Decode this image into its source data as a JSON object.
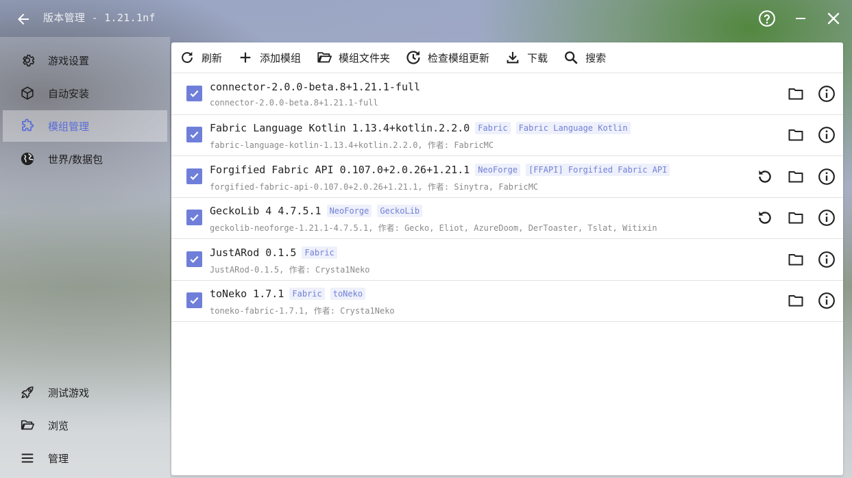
{
  "window": {
    "title": "版本管理 - 1.21.1nf",
    "help_icon": "help-circle-icon",
    "minimize_icon": "minimize-icon",
    "close_icon": "close-icon"
  },
  "sidebar": {
    "items": [
      {
        "label": "游戏设置",
        "icon": "gear-icon",
        "active": false
      },
      {
        "label": "自动安装",
        "icon": "cube-icon",
        "active": false
      },
      {
        "label": "模组管理",
        "icon": "puzzle-icon",
        "active": true
      },
      {
        "label": "世界/数据包",
        "icon": "globe-icon",
        "active": false
      }
    ],
    "bottom_items": [
      {
        "label": "测试游戏",
        "icon": "rocket-icon"
      },
      {
        "label": "浏览",
        "icon": "folder-open-icon"
      },
      {
        "label": "管理",
        "icon": "menu-icon"
      }
    ]
  },
  "toolbar": {
    "refresh": "刷新",
    "add_mod": "添加模组",
    "mod_folder": "模组文件夹",
    "check_updates": "检查模组更新",
    "download": "下载",
    "search": "搜索"
  },
  "mods": [
    {
      "name": "connector-2.0.0-beta.8+1.21.1-full",
      "tags": [],
      "sub": "connector-2.0.0-beta.8+1.21.1-full",
      "enabled": true,
      "has_revert": false
    },
    {
      "name": "Fabric Language Kotlin 1.13.4+kotlin.2.2.0",
      "tags": [
        "Fabric",
        "Fabric Language Kotlin"
      ],
      "sub": "fabric-language-kotlin-1.13.4+kotlin.2.2.0, 作者: FabricMC",
      "enabled": true,
      "has_revert": false
    },
    {
      "name": "Forgified Fabric API 0.107.0+2.0.26+1.21.1",
      "tags": [
        "NeoForge",
        "[FFAPI] Forgified Fabric API"
      ],
      "sub": "forgified-fabric-api-0.107.0+2.0.26+1.21.1, 作者: Sinytra, FabricMC",
      "enabled": true,
      "has_revert": true
    },
    {
      "name": "GeckoLib 4 4.7.5.1",
      "tags": [
        "NeoForge",
        "GeckoLib"
      ],
      "sub": "geckolib-neoforge-1.21.1-4.7.5.1, 作者: Gecko, Eliot, AzureDoom, DerToaster, Tslat, Witixin",
      "enabled": true,
      "has_revert": true
    },
    {
      "name": "JustARod 0.1.5",
      "tags": [
        "Fabric"
      ],
      "sub": "JustARod-0.1.5, 作者: Crysta1Neko",
      "enabled": true,
      "has_revert": false
    },
    {
      "name": "toNeko 1.7.1",
      "tags": [
        "Fabric",
        "toNeko"
      ],
      "sub": "toneko-fabric-1.7.1, 作者: Crysta1Neko",
      "enabled": true,
      "has_revert": false
    }
  ],
  "colors": {
    "accent": "#6f7fd9",
    "tag_bg": "#eef0fb",
    "tag_text": "#7281d6"
  }
}
